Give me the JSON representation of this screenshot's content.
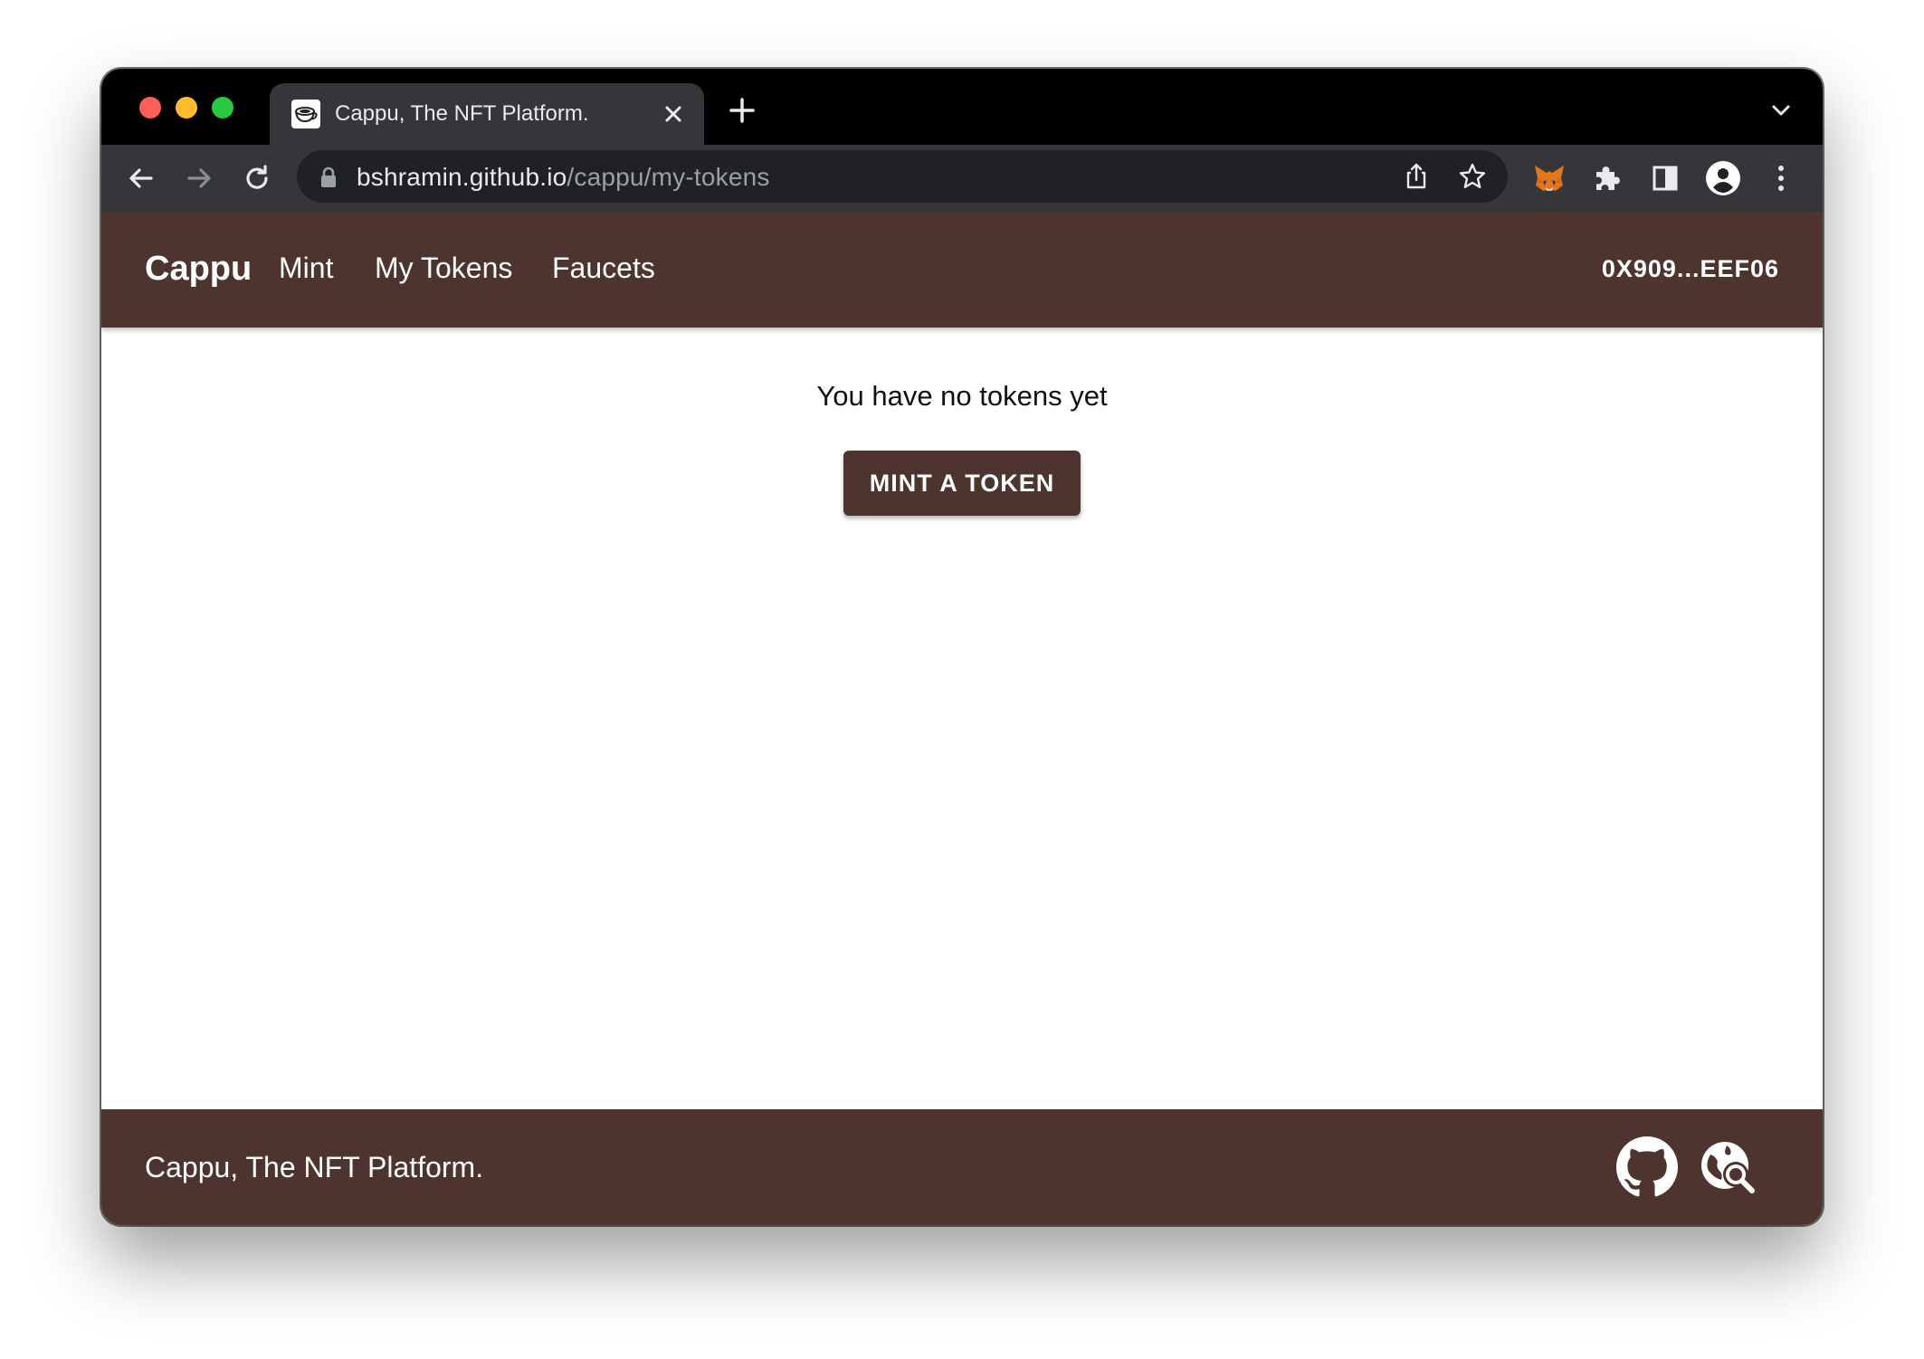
{
  "browser": {
    "tab": {
      "title": "Cappu, The NFT Platform.",
      "favicon": "coffee-cup-icon",
      "close": "✕"
    },
    "new_tab": "+",
    "url": {
      "host": "bshramin.github.io",
      "path": "/cappu/my-tokens"
    },
    "icons": [
      "back-arrow-icon",
      "forward-arrow-icon",
      "reload-icon",
      "lock-icon",
      "share-icon",
      "star-icon",
      "metamask-fox-icon",
      "extensions-puzzle-icon",
      "side-panel-icon",
      "profile-avatar-icon",
      "kebab-menu-icon",
      "tab-list-chevron-icon"
    ]
  },
  "header": {
    "brand": "Cappu",
    "nav": [
      {
        "label": "Mint"
      },
      {
        "label": "My Tokens"
      },
      {
        "label": "Faucets"
      }
    ],
    "account": "0X909...EEF06"
  },
  "main": {
    "empty_message": "You have no tokens yet",
    "mint_button": "MINT A TOKEN"
  },
  "footer": {
    "text": "Cappu, The NFT Platform.",
    "icons": [
      "github-icon",
      "explorer-search-icon"
    ]
  },
  "colors": {
    "brand": "#4e342e",
    "chrome_dark": "#35363a",
    "tabstrip": "#000000"
  }
}
